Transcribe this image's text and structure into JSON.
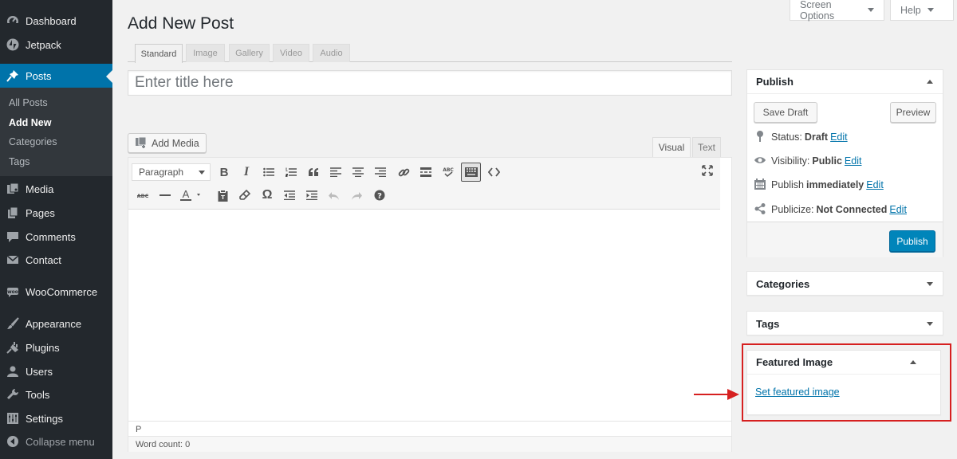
{
  "sidebar": {
    "items": [
      {
        "label": "Dashboard",
        "icon": "dashboard-icon"
      },
      {
        "label": "Jetpack",
        "icon": "jetpack-icon"
      },
      {
        "label": "Posts",
        "icon": "pin-icon"
      },
      {
        "label": "Media",
        "icon": "media-icon"
      },
      {
        "label": "Pages",
        "icon": "pages-icon"
      },
      {
        "label": "Comments",
        "icon": "comment-icon"
      },
      {
        "label": "Contact",
        "icon": "mail-icon"
      },
      {
        "label": "WooCommerce",
        "icon": "woocommerce-icon"
      },
      {
        "label": "Appearance",
        "icon": "brush-icon"
      },
      {
        "label": "Plugins",
        "icon": "plugin-icon"
      },
      {
        "label": "Users",
        "icon": "user-icon"
      },
      {
        "label": "Tools",
        "icon": "wrench-icon"
      },
      {
        "label": "Settings",
        "icon": "settings-icon"
      }
    ],
    "submenu": [
      "All Posts",
      "Add New",
      "Categories",
      "Tags"
    ],
    "collapse_label": "Collapse menu",
    "colors": {
      "background": "#23282d",
      "active": "#0073aa"
    }
  },
  "top": {
    "screen_options": "Screen Options",
    "help": "Help"
  },
  "page_title": "Add New Post",
  "format_tabs": [
    "Standard",
    "Image",
    "Gallery",
    "Video",
    "Audio"
  ],
  "title_input": {
    "placeholder": "Enter title here",
    "value": ""
  },
  "editor": {
    "add_media": "Add Media",
    "tab_visual": "Visual",
    "tab_text": "Text",
    "format_select": "Paragraph",
    "path": "P",
    "word_count": "Word count: 0"
  },
  "publish": {
    "title": "Publish",
    "save_draft": "Save Draft",
    "preview": "Preview",
    "status_label": "Status:",
    "status_value": "Draft",
    "visibility_label": "Visibility:",
    "visibility_value": "Public",
    "publish_label": "Publish",
    "publish_value": "immediately",
    "publicize_label": "Publicize:",
    "publicize_value": "Not Connected",
    "edit": "Edit",
    "publish_button": "Publish",
    "primary_color": "#0085ba"
  },
  "categories": {
    "title": "Categories"
  },
  "tags": {
    "title": "Tags"
  },
  "featured_image": {
    "title": "Featured Image",
    "link": "Set featured image",
    "highlight_color": "#d62020"
  }
}
